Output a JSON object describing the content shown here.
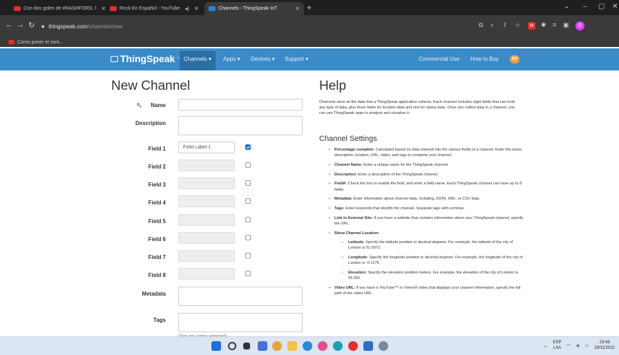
{
  "browser": {
    "tabs": [
      {
        "title": "Con dos goles de #RASHFORD, I",
        "favicon": "youtube-icon"
      },
      {
        "title": "Rock En Español - YouTube",
        "favicon": "youtube-icon"
      },
      {
        "title": "Channels - ThingSpeak IoT",
        "favicon": "thingspeak-icon",
        "active": true
      }
    ],
    "new_tab": "+",
    "url_host": "thingspeak.com",
    "url_path": "/channels/new",
    "bookmark": "Cómo poner el soni...",
    "profile_initial": "D",
    "window_controls": [
      "⌄",
      "–",
      "▢",
      "✕"
    ]
  },
  "site_nav": {
    "logo": "ThingSpeak",
    "logo_tm": "™",
    "items": [
      "Channels ▾",
      "Apps ▾",
      "Devices ▾",
      "Support ▾"
    ],
    "right_items": [
      "Commercial Use",
      "How to Buy"
    ],
    "avatar": "DP",
    "brand_color": "#3a8bc8"
  },
  "form": {
    "title": "New Channel",
    "name_label": "Name",
    "description_label": "Description",
    "fields": [
      {
        "label": "Field 1",
        "value": "Field Label 1",
        "checked": true
      },
      {
        "label": "Field 2",
        "value": "",
        "checked": false
      },
      {
        "label": "Field 3",
        "value": "",
        "checked": false
      },
      {
        "label": "Field 4",
        "value": "",
        "checked": false
      },
      {
        "label": "Field 5",
        "value": "",
        "checked": false
      },
      {
        "label": "Field 6",
        "value": "",
        "checked": false
      },
      {
        "label": "Field 7",
        "value": "",
        "checked": false
      },
      {
        "label": "Field 8",
        "value": "",
        "checked": false
      }
    ],
    "metadata_label": "Metadata",
    "tags_label": "Tags",
    "tags_hint": "(Tags are comma separated)"
  },
  "help": {
    "title": "Help",
    "intro": "Channels store all the data that a ThingSpeak application collects. Each channel includes eight fields that can hold any type of data, plus three fields for location data and one for status data. Once you collect data in a channel, you can use ThingSpeak apps to analyze and visualize it.",
    "settings_title": "Channel Settings",
    "items": [
      {
        "term": "Percentage complete:",
        "text": " Calculated based on data entered into the various fields of a channel. Enter the name, description, location, URL, video, and tags to complete your channel."
      },
      {
        "term": "Channel Name:",
        "text": " Enter a unique name for the ThingSpeak channel."
      },
      {
        "term": "Description:",
        "text": " Enter a description of the ThingSpeak channel."
      },
      {
        "term": "Field#:",
        "text": " Check the box to enable the field, and enter a field name. Each ThingSpeak channel can have up to 8 fields."
      },
      {
        "term": "Metadata:",
        "text": " Enter information about channel data, including JSON, XML, or CSV data."
      },
      {
        "term": "Tags:",
        "text": " Enter keywords that identify the channel. Separate tags with commas."
      },
      {
        "term": "Link to External Site:",
        "text": " If you have a website that contains information about your ThingSpeak channel, specify the URL."
      },
      {
        "term": "Show Channel Location:",
        "text": ""
      },
      {
        "term": "Latitude:",
        "text": " Specify the latitude position in decimal degrees. For example, the latitude of the city of London is 51.5072.",
        "sub": true
      },
      {
        "term": "Longitude:",
        "text": " Specify the longitude position in decimal degrees. For example, the longitude of the city of London is -0.1275.",
        "sub": true
      },
      {
        "term": "Elevation:",
        "text": " Specify the elevation position meters. For example, the elevation of the city of London is 35.052.",
        "sub": true
      },
      {
        "term": "Video URL:",
        "text": " If you have a YouTube™ or Vimeo® video that displays your channel information, specify the full path of the video URL."
      }
    ]
  },
  "taskbar": {
    "lang": "ESP",
    "lang_sub": "LAA",
    "time": "23:49",
    "date": "29/11/2022"
  }
}
